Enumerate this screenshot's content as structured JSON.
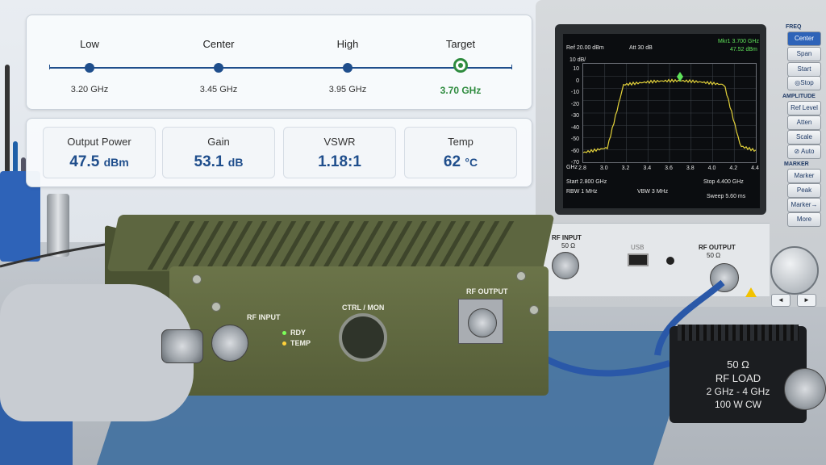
{
  "frequency_selector": {
    "points": [
      {
        "label": "Low",
        "value": "3.20 GHz"
      },
      {
        "label": "Center",
        "value": "3.45 GHz"
      },
      {
        "label": "High",
        "value": "3.95 GHz"
      },
      {
        "label": "Target",
        "value": "3.70 GHz"
      }
    ],
    "selected": "Target"
  },
  "metrics": [
    {
      "label": "Output Power",
      "value": "47.5",
      "unit": "dBm"
    },
    {
      "label": "Gain",
      "value": "53.1",
      "unit": "dB"
    },
    {
      "label": "VSWR",
      "value": "1.18:1",
      "unit": ""
    },
    {
      "label": "Temp",
      "value": "62",
      "unit": "°C"
    }
  ],
  "amplifier": {
    "rf_input": "RF INPUT",
    "ctrl_mon": "CTRL / MON",
    "rf_output": "RF OUTPUT",
    "led_rdy": "RDY",
    "led_temp": "TEMP"
  },
  "rf_load": {
    "line1": "50 Ω",
    "line2": "RF LOAD",
    "line3": "2 GHz - 4 GHz",
    "line4": "100 W CW"
  },
  "analyzer": {
    "ref": "Ref 20.00 dBm",
    "att": "Att 30 dB",
    "marker": "Mkr1 3.700 GHz",
    "marker_level": "47.52 dBm",
    "scale": "10 dB/",
    "y_ticks": [
      "10",
      "0",
      "-10",
      "-20",
      "-30",
      "-40",
      "-50",
      "-60",
      "-70"
    ],
    "x_ticks": [
      "2.8",
      "3.0",
      "3.2",
      "3.4",
      "3.6",
      "3.8",
      "4.0",
      "4.2",
      "4.4"
    ],
    "x_unit": "GHz",
    "start": "Start 2.800 GHz",
    "stop": "Stop 4.400 GHz",
    "rbw": "RBW 1 MHz",
    "vbw": "VBW 3 MHz",
    "sweep": "Sweep 5.60 ms",
    "sections": {
      "freq": "FREQ",
      "amplitude": "AMPLITUDE",
      "marker": "MARKER"
    },
    "buttons": {
      "center": "Center",
      "span": "Span",
      "start": "Start",
      "stop": "◎Stop",
      "ref_level": "Ref Level",
      "atten": "Atten",
      "scale": "Scale",
      "auto": "⊘ Auto",
      "marker": "Marker",
      "peak": "Peak",
      "marker_to": "Marker→",
      "more": "More"
    },
    "ports": {
      "rf_input": "RF INPUT",
      "rf_input_sub": "50 Ω",
      "usb": "USB",
      "rf_output": "RF OUTPUT",
      "rf_output_sub": "50 Ω"
    },
    "nav": {
      "left": "◄",
      "right": "►"
    },
    "trace_color": "#e3d23a",
    "marker_color": "#5fe35a"
  },
  "colors": {
    "accent": "#1f4e8c",
    "target": "#2e8b3e"
  }
}
